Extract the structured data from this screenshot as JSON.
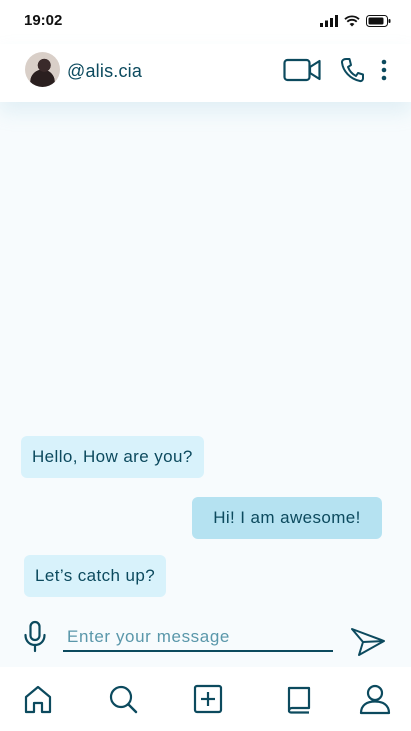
{
  "status_bar": {
    "time": "19:02"
  },
  "header": {
    "username": "@alis.cia"
  },
  "messages": [
    {
      "direction": "in",
      "text": "Hello, How are you?"
    },
    {
      "direction": "out",
      "text": "Hi! I am awesome!"
    },
    {
      "direction": "in",
      "text": "Let’s catch up?"
    }
  ],
  "composer": {
    "placeholder": "Enter your message"
  },
  "icons": {
    "header": [
      "video-call-icon",
      "phone-icon",
      "more-vertical-icon"
    ],
    "composer": [
      "microphone-icon",
      "send-icon"
    ],
    "nav": [
      "home-icon",
      "search-icon",
      "add-icon",
      "book-icon",
      "profile-icon"
    ]
  },
  "colors": {
    "accent": "#0c4a5e",
    "incoming_bubble": "#d8f2fb",
    "outgoing_bubble": "#b5e2f1",
    "background": "#f7fbfd"
  }
}
